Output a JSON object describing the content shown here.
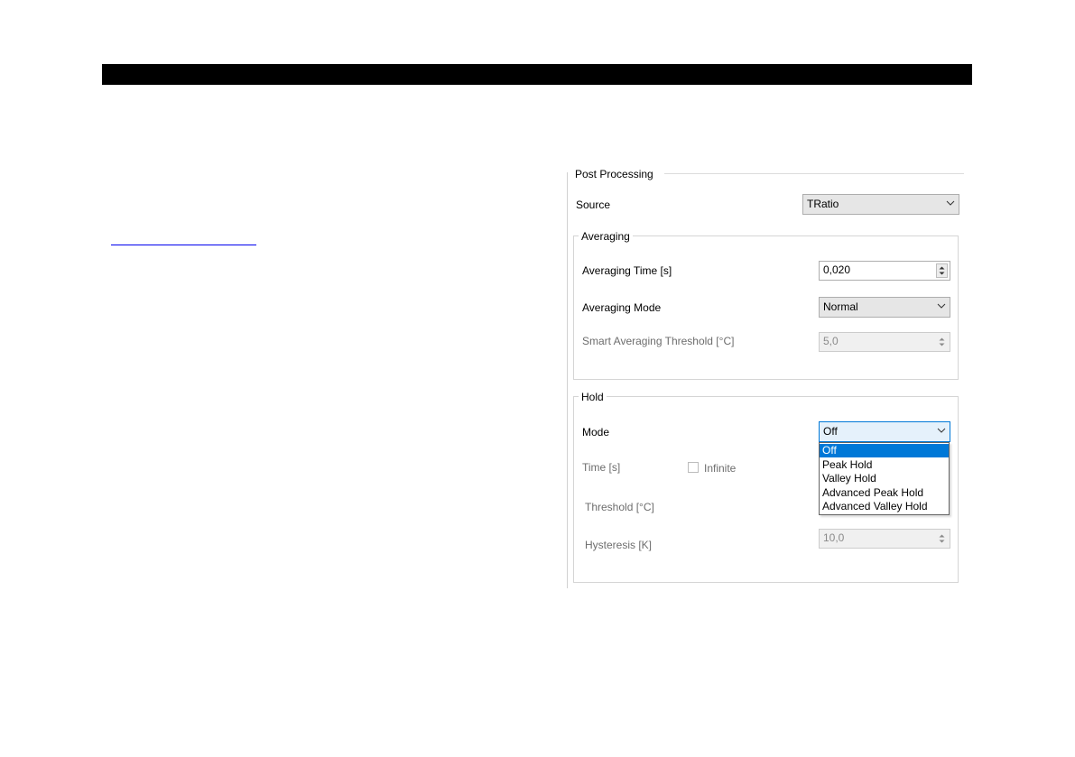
{
  "post_processing": {
    "title": "Post Processing",
    "source_label": "Source",
    "source_value": "TRatio"
  },
  "averaging": {
    "title": "Averaging",
    "time_label": "Averaging Time [s]",
    "time_value": "0,020",
    "mode_label": "Averaging Mode",
    "mode_value": "Normal",
    "smart_threshold_label": "Smart Averaging Threshold [°C]",
    "smart_threshold_value": "5,0"
  },
  "hold": {
    "title": "Hold",
    "mode_label": "Mode",
    "mode_value": "Off",
    "time_label": "Time [s]",
    "infinite_label": "Infinite",
    "threshold_label": "Threshold [°C]",
    "hysteresis_label": "Hysteresis [K]",
    "hysteresis_value": "10,0",
    "mode_options": [
      "Off",
      "Peak Hold",
      "Valley Hold",
      "Advanced Peak Hold",
      "Advanced Valley Hold"
    ],
    "selected_option": "Off"
  },
  "colors": {
    "selection": "#0078d7",
    "link": "#0000ee"
  },
  "icons": {
    "combo_arrow": "chevron-down-icon",
    "spinner": "spin-arrows-icon"
  }
}
